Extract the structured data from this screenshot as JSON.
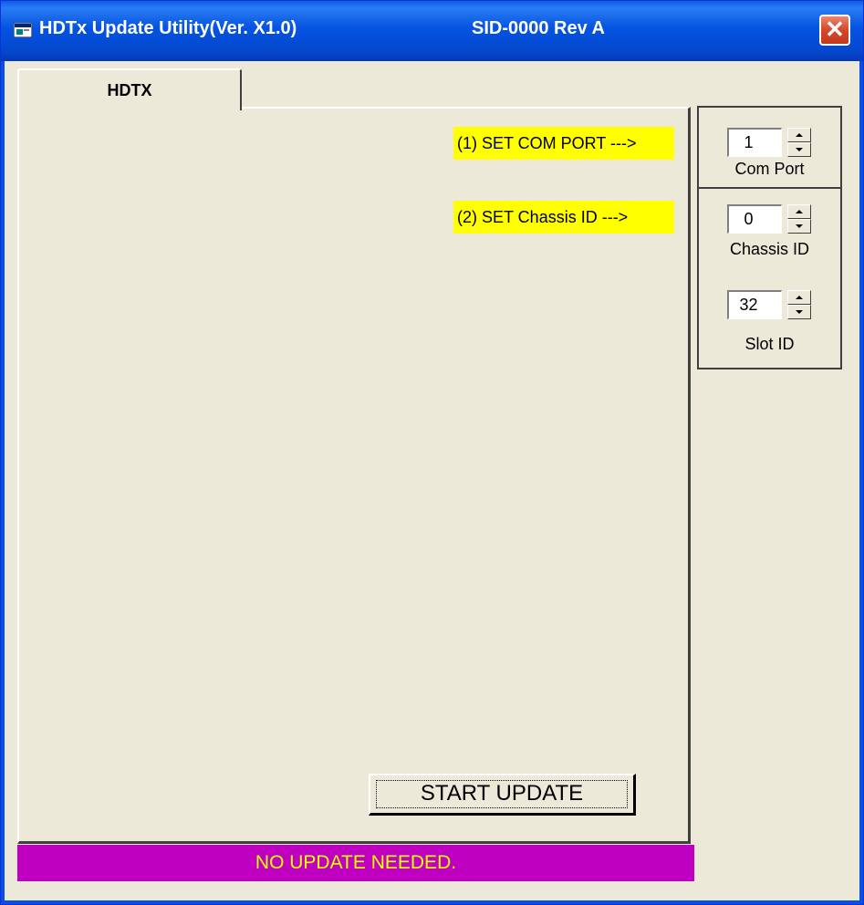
{
  "window": {
    "title": "HDTx Update Utility(Ver. X1.0)",
    "subtitle": "SID-0000 Rev A",
    "close_glyph": "✕",
    "icon": "app-window-icon"
  },
  "tabs": [
    {
      "label": "HDTX",
      "active": true
    }
  ],
  "hints": {
    "com_port": "(1)  SET COM PORT --->",
    "chassis_id": "(2)  SET Chassis ID --->"
  },
  "start_button": {
    "label": "START UPDATE"
  },
  "status": {
    "text": "NO UPDATE NEEDED."
  },
  "controls": {
    "com_port": {
      "value": "1",
      "label": "Com Port"
    },
    "chassis_id": {
      "value": "0",
      "label": "Chassis ID"
    },
    "slot_id": {
      "value": "32",
      "label": "Slot ID"
    }
  },
  "colors": {
    "hint_background": "#ffff00",
    "status_background": "#c000c0",
    "status_text": "#ffff00",
    "title_bar": "#0553e1"
  }
}
